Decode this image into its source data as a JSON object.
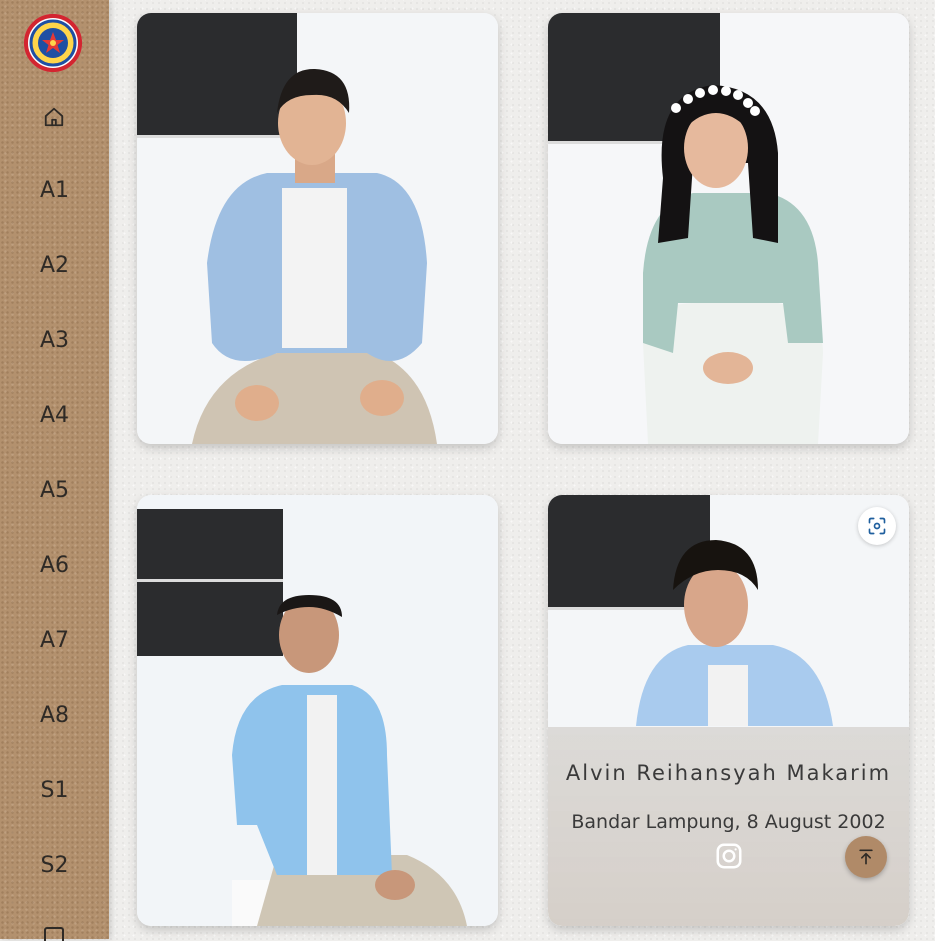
{
  "sidebar": {
    "logo_icon": "school-emblem-icon",
    "home_icon": "home-icon",
    "items": [
      {
        "label": "A1"
      },
      {
        "label": "A2"
      },
      {
        "label": "A3"
      },
      {
        "label": "A4"
      },
      {
        "label": "A5"
      },
      {
        "label": "A6"
      },
      {
        "label": "A7"
      },
      {
        "label": "A8"
      },
      {
        "label": "S1"
      },
      {
        "label": "S2"
      }
    ]
  },
  "cards": [
    {
      "photo": "student-photo-1"
    },
    {
      "photo": "student-photo-2"
    },
    {
      "photo": "student-photo-3"
    },
    {
      "photo": "student-photo-4",
      "name": "Alvin Reihansyah Makarim",
      "birth": "Bandar Lampung, 8 August 2002",
      "social_icon": "instagram-icon",
      "scan_icon": "scan-icon",
      "top_icon": "arrow-to-top-icon"
    }
  ],
  "colors": {
    "sidebar": "#b3916e",
    "background": "#efeeec",
    "accent_button": "#b08a68",
    "text": "#3a3a3a"
  }
}
